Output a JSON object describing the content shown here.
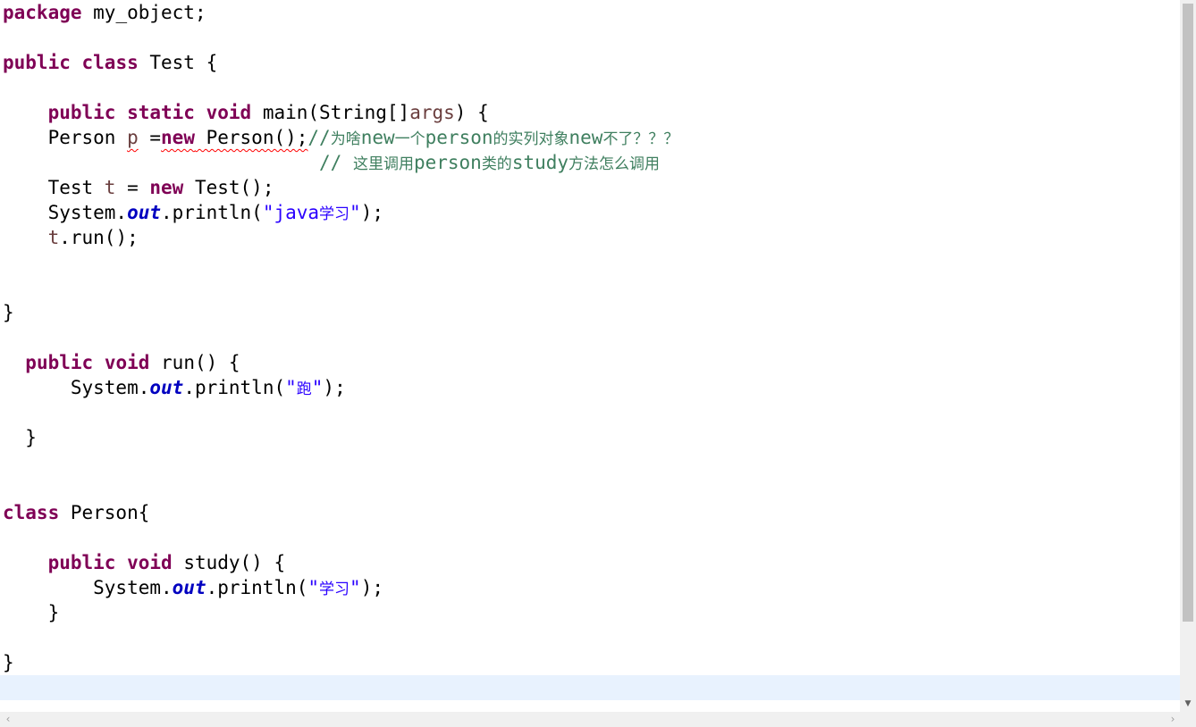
{
  "editor": {
    "language": "java",
    "current_line_highlight": "#e8f2fe",
    "colors": {
      "keyword": "#7f0055",
      "string": "#2a00ff",
      "comment": "#3f7f5f",
      "static_field": "#0000c0",
      "local_variable": "#6a3e3e",
      "error_underline": "#ff0000"
    },
    "lines": [
      {
        "tokens": [
          {
            "t": "package",
            "c": "kw"
          },
          {
            "t": " my_object;"
          }
        ]
      },
      {
        "tokens": []
      },
      {
        "tokens": [
          {
            "t": "public",
            "c": "kw"
          },
          {
            "t": " "
          },
          {
            "t": "class",
            "c": "kw"
          },
          {
            "t": " Test {"
          }
        ]
      },
      {
        "tokens": []
      },
      {
        "tokens": [
          {
            "t": "    "
          },
          {
            "t": "public",
            "c": "kw"
          },
          {
            "t": " "
          },
          {
            "t": "static",
            "c": "kw"
          },
          {
            "t": " "
          },
          {
            "t": "void",
            "c": "kw"
          },
          {
            "t": " main(String[]"
          },
          {
            "t": "args",
            "c": "var"
          },
          {
            "t": ") {"
          }
        ]
      },
      {
        "tokens": [
          {
            "t": "    Person "
          },
          {
            "t": "p",
            "c": "var err"
          },
          {
            "t": " ="
          },
          {
            "t": "new",
            "c": "kw err"
          },
          {
            "t": " Person();",
            "c": "err"
          },
          {
            "t": "//",
            "c": "cmt"
          },
          {
            "t": "为啥",
            "c": "cmt cjk"
          },
          {
            "t": "new",
            "c": "cmt"
          },
          {
            "t": "一个",
            "c": "cmt cjk"
          },
          {
            "t": "person",
            "c": "cmt"
          },
          {
            "t": "的实列对象",
            "c": "cmt cjk"
          },
          {
            "t": "new",
            "c": "cmt"
          },
          {
            "t": "不了？？？",
            "c": "cmt cjk"
          }
        ]
      },
      {
        "tokens": [
          {
            "t": "                            "
          },
          {
            "t": "// ",
            "c": "cmt"
          },
          {
            "t": "这里调用",
            "c": "cmt cjk"
          },
          {
            "t": "person",
            "c": "cmt"
          },
          {
            "t": "类的",
            "c": "cmt cjk"
          },
          {
            "t": "study",
            "c": "cmt"
          },
          {
            "t": "方法怎么调用",
            "c": "cmt cjk"
          }
        ]
      },
      {
        "tokens": [
          {
            "t": "    Test "
          },
          {
            "t": "t",
            "c": "var"
          },
          {
            "t": " = "
          },
          {
            "t": "new",
            "c": "kw"
          },
          {
            "t": " Test();"
          }
        ]
      },
      {
        "tokens": [
          {
            "t": "    System."
          },
          {
            "t": "out",
            "c": "field"
          },
          {
            "t": ".println("
          },
          {
            "t": "\"java",
            "c": "str"
          },
          {
            "t": "学习",
            "c": "str cjk"
          },
          {
            "t": "\"",
            "c": "str"
          },
          {
            "t": ");"
          }
        ]
      },
      {
        "tokens": [
          {
            "t": "    "
          },
          {
            "t": "t",
            "c": "var"
          },
          {
            "t": ".run();"
          }
        ]
      },
      {
        "tokens": []
      },
      {
        "tokens": []
      },
      {
        "tokens": [
          {
            "t": "}"
          }
        ]
      },
      {
        "tokens": []
      },
      {
        "tokens": [
          {
            "t": "  "
          },
          {
            "t": "public",
            "c": "kw"
          },
          {
            "t": " "
          },
          {
            "t": "void",
            "c": "kw"
          },
          {
            "t": " run() {"
          }
        ]
      },
      {
        "tokens": [
          {
            "t": "      System."
          },
          {
            "t": "out",
            "c": "field"
          },
          {
            "t": ".println("
          },
          {
            "t": "\"",
            "c": "str"
          },
          {
            "t": "跑",
            "c": "str cjk"
          },
          {
            "t": "\"",
            "c": "str"
          },
          {
            "t": ");"
          }
        ]
      },
      {
        "tokens": []
      },
      {
        "tokens": [
          {
            "t": "  }"
          }
        ]
      },
      {
        "tokens": []
      },
      {
        "tokens": []
      },
      {
        "tokens": [
          {
            "t": "class",
            "c": "kw"
          },
          {
            "t": " Person{"
          }
        ]
      },
      {
        "tokens": []
      },
      {
        "tokens": [
          {
            "t": "    "
          },
          {
            "t": "public",
            "c": "kw"
          },
          {
            "t": " "
          },
          {
            "t": "void",
            "c": "kw"
          },
          {
            "t": " study() {"
          }
        ]
      },
      {
        "tokens": [
          {
            "t": "        System."
          },
          {
            "t": "out",
            "c": "field"
          },
          {
            "t": ".println("
          },
          {
            "t": "\"",
            "c": "str"
          },
          {
            "t": "学习",
            "c": "str cjk"
          },
          {
            "t": "\"",
            "c": "str"
          },
          {
            "t": ");"
          }
        ]
      },
      {
        "tokens": [
          {
            "t": "    }"
          }
        ]
      },
      {
        "tokens": []
      },
      {
        "tokens": [
          {
            "t": "}"
          }
        ]
      },
      {
        "tokens": []
      }
    ]
  },
  "scrollbars": {
    "vertical_down_icon": "▼",
    "horizontal_left_icon": "‹",
    "horizontal_right_icon": "›"
  }
}
